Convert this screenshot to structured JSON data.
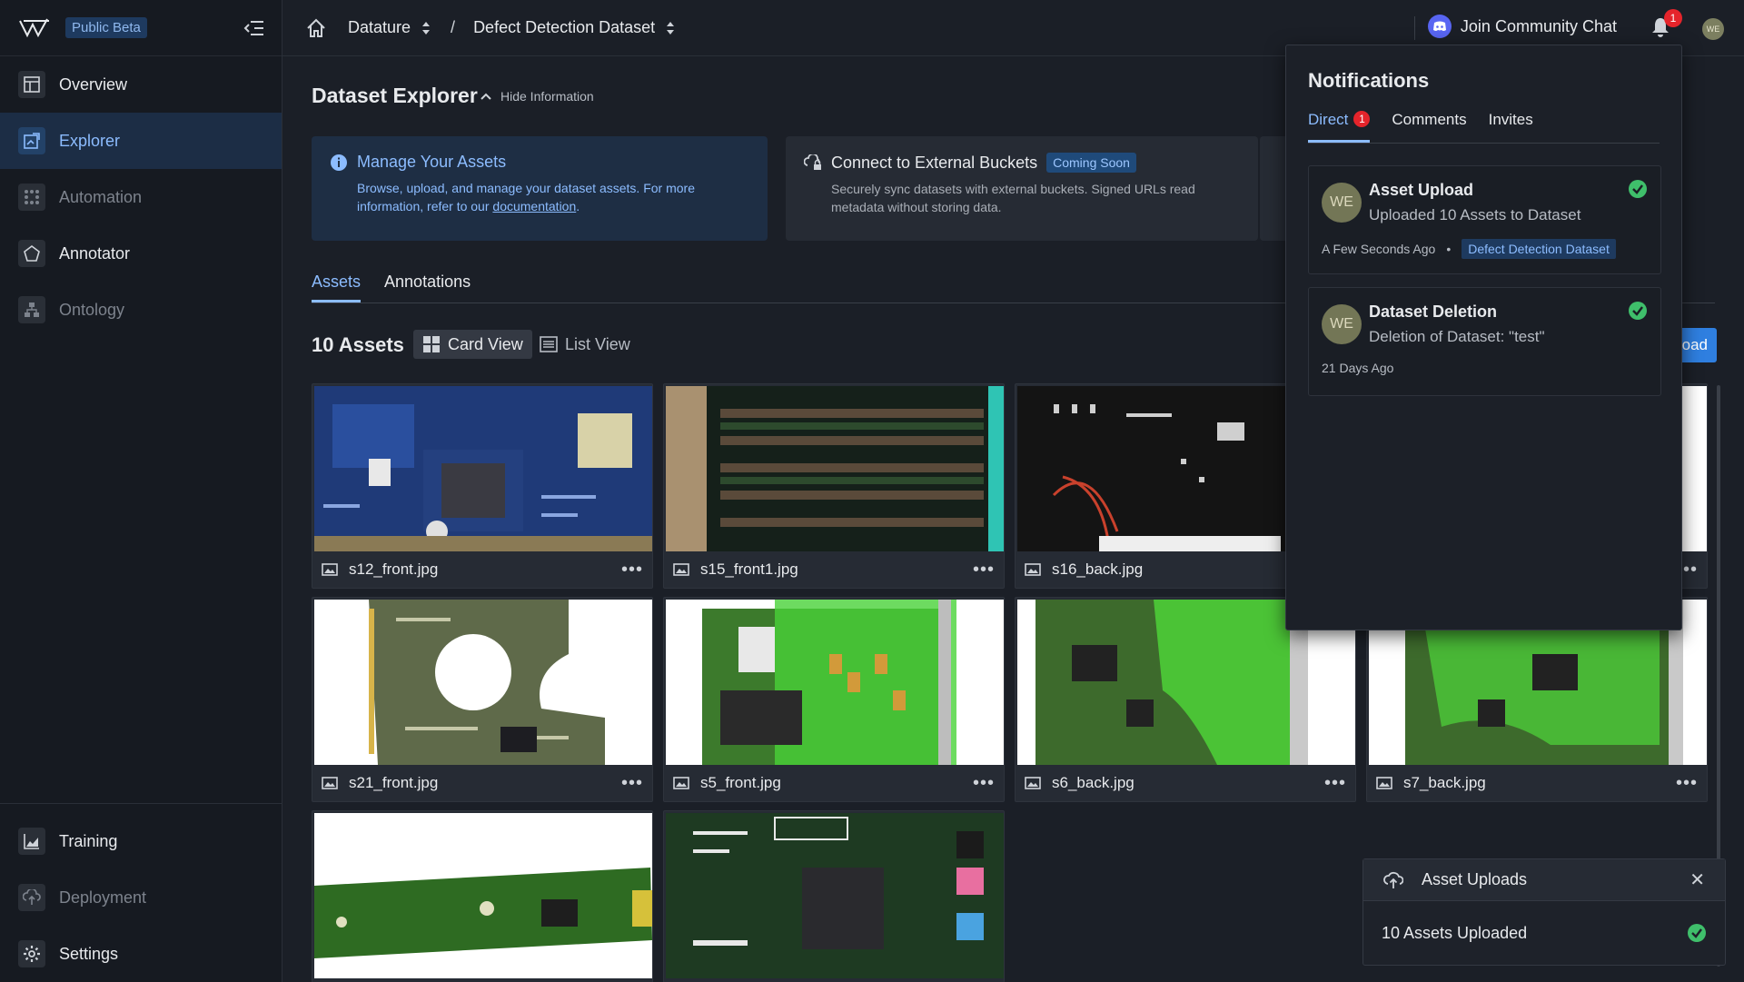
{
  "app": {
    "beta_badge": "Public Beta",
    "user_initials": "WE",
    "notification_count": "1"
  },
  "sidebar": {
    "items": [
      {
        "label": "Overview",
        "icon": "layout-icon"
      },
      {
        "label": "Explorer",
        "icon": "explorer-icon",
        "active": true
      },
      {
        "label": "Automation",
        "icon": "automation-icon"
      },
      {
        "label": "Annotator",
        "icon": "annotator-icon"
      },
      {
        "label": "Ontology",
        "icon": "ontology-icon"
      }
    ],
    "bottom": [
      {
        "label": "Training",
        "icon": "chart-icon"
      },
      {
        "label": "Deployment",
        "icon": "cloud-upload-icon"
      },
      {
        "label": "Settings",
        "icon": "gear-icon"
      }
    ]
  },
  "topbar": {
    "breadcrumb": [
      "Datature",
      "Defect Detection Dataset"
    ],
    "separator": "/",
    "community": "Join Community Chat"
  },
  "main": {
    "title": "Dataset Explorer",
    "hide_info": "Hide Information",
    "info_cards": [
      {
        "title": "Manage Your Assets",
        "body": "Browse, upload, and manage your dataset assets. For more information, refer to our",
        "link": "documentation",
        "tail": "."
      },
      {
        "title": "Connect to External Buckets",
        "badge": "Coming Soon",
        "body": "Securely sync datasets with external buckets. Signed URLs read metadata without storing data."
      }
    ],
    "tabs": [
      "Assets",
      "Annotations"
    ],
    "asset_count": "10 Assets",
    "card_view": "Card View",
    "list_view": "List View",
    "upload_label": "oad"
  },
  "assets": [
    {
      "name": "s12_front.jpg"
    },
    {
      "name": "s15_front1.jpg"
    },
    {
      "name": "s16_back.jpg"
    },
    {
      "name": ""
    },
    {
      "name": "s21_front.jpg"
    },
    {
      "name": "s5_front.jpg"
    },
    {
      "name": "s6_back.jpg"
    },
    {
      "name": "s7_back.jpg"
    },
    {
      "name": ""
    },
    {
      "name": ""
    }
  ],
  "notifications": {
    "title": "Notifications",
    "tabs": [
      {
        "label": "Direct",
        "badge": "1"
      },
      {
        "label": "Comments"
      },
      {
        "label": "Invites"
      }
    ],
    "items": [
      {
        "avatar": "WE",
        "title": "Asset Upload",
        "body": "Uploaded 10 Assets to Dataset",
        "time": "A Few Seconds Ago",
        "tag": "Defect Detection Dataset"
      },
      {
        "avatar": "WE",
        "title": "Dataset Deletion",
        "body": "Deletion of Dataset: \"test\"",
        "time": "21 Days Ago"
      }
    ]
  },
  "toast": {
    "title": "Asset Uploads",
    "body": "10 Assets Uploaded"
  },
  "colors": {
    "accent": "#8cbcff",
    "success": "#3fbf6b",
    "badge": "#e5242b"
  }
}
